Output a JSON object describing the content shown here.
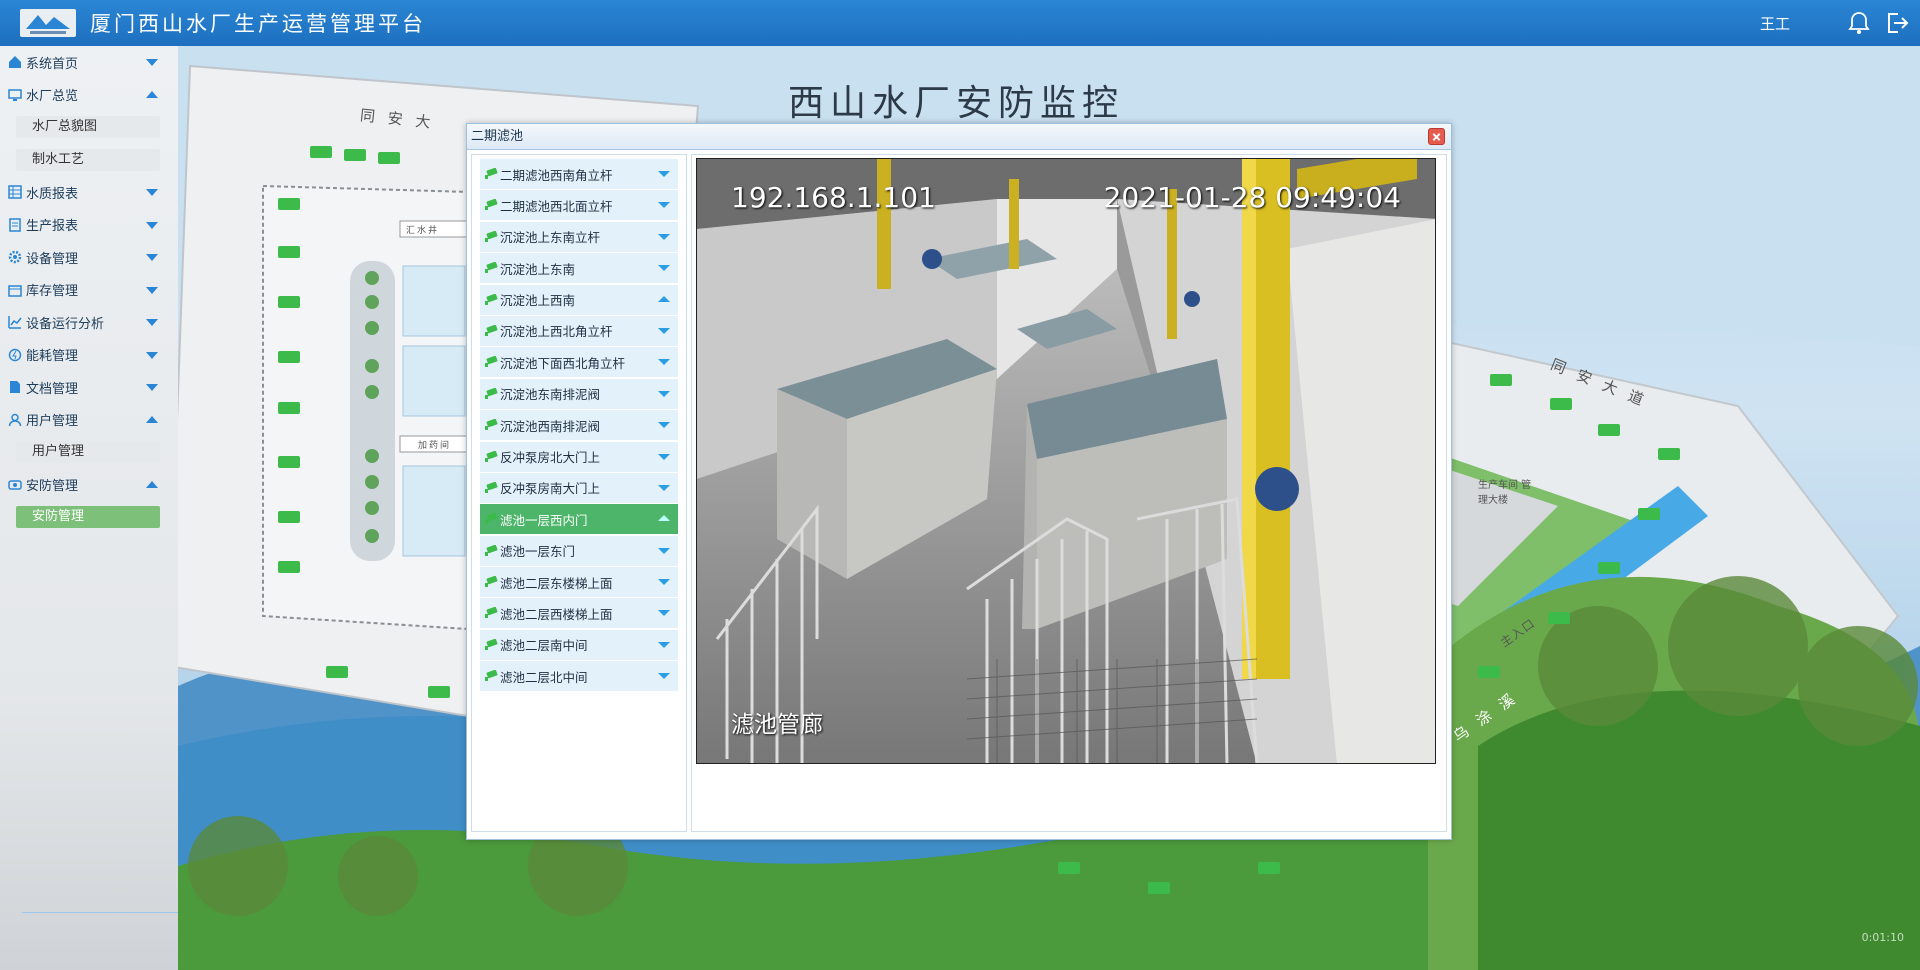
{
  "header": {
    "app_title": "厦门西山水厂生产运营管理平台",
    "user": "王工",
    "bell_icon": "bell-icon",
    "logout_icon": "logout-icon"
  },
  "sidebar": {
    "items": [
      {
        "label": "系统首页",
        "icon": "home-icon",
        "expanded": false
      },
      {
        "label": "水厂总览",
        "icon": "monitor-icon",
        "expanded": true
      },
      {
        "label": "水厂总貌图",
        "sub": true
      },
      {
        "label": "制水工艺",
        "sub": true
      },
      {
        "label": "水质报表",
        "icon": "table-icon",
        "expanded": false
      },
      {
        "label": "生产报表",
        "icon": "report-icon",
        "expanded": false
      },
      {
        "label": "设备管理",
        "icon": "gear-icon",
        "expanded": false
      },
      {
        "label": "库存管理",
        "icon": "box-icon",
        "expanded": false
      },
      {
        "label": "设备运行分析",
        "icon": "chart-icon",
        "expanded": false
      },
      {
        "label": "能耗管理",
        "icon": "energy-icon",
        "expanded": false
      },
      {
        "label": "文档管理",
        "icon": "document-icon",
        "expanded": false
      },
      {
        "label": "用户管理",
        "icon": "user-icon",
        "expanded": true
      },
      {
        "label": "用户管理",
        "sub": true
      },
      {
        "label": "安防管理",
        "icon": "shield-icon",
        "expanded": true
      },
      {
        "label": "安防管理",
        "sub": true,
        "active": true
      }
    ]
  },
  "main": {
    "page_title": "西山水厂安防监控",
    "map_labels": {
      "road_top": "同 安 大",
      "road_right": "同 安 大 道",
      "main_entrance": "主入口",
      "creek": "乌 涂 溪",
      "building": "生产车间 管理大楼",
      "water_well": "汇水井",
      "dosing": "加药间"
    },
    "timecode": "0:01:10"
  },
  "dialog": {
    "title": "二期滤池",
    "close_icon": "close-icon",
    "cameras": [
      {
        "label": "二期滤池西南角立杆",
        "dir": "down"
      },
      {
        "label": "二期滤池西北面立杆",
        "dir": "down"
      },
      {
        "label": "沉淀池上东南立杆",
        "dir": "down"
      },
      {
        "label": "沉淀池上东南",
        "dir": "down"
      },
      {
        "label": "沉淀池上西南",
        "dir": "up"
      },
      {
        "label": "沉淀池上西北角立杆",
        "dir": "down"
      },
      {
        "label": "沉淀池下面西北角立杆",
        "dir": "down"
      },
      {
        "label": "沉淀池东南排泥阀",
        "dir": "down"
      },
      {
        "label": "沉淀池西南排泥阀",
        "dir": "down"
      },
      {
        "label": "反冲泵房北大门上",
        "dir": "down"
      },
      {
        "label": "反冲泵房南大门上",
        "dir": "down"
      },
      {
        "label": "滤池一层西内门",
        "dir": "up",
        "active": true
      },
      {
        "label": "滤池一层东门",
        "dir": "down"
      },
      {
        "label": "滤池二层东楼梯上面",
        "dir": "down"
      },
      {
        "label": "滤池二层西楼梯上面",
        "dir": "down"
      },
      {
        "label": "滤池二层南中间",
        "dir": "down"
      },
      {
        "label": "滤池二层北中间",
        "dir": "down"
      }
    ],
    "video": {
      "ip": "192.168.1.101",
      "timestamp": "2021-01-28 09:49:04",
      "location_label": "滤池管廊"
    }
  },
  "colors": {
    "header_blue": "#1d6fbf",
    "active_green": "#4db56a",
    "sidebar_active": "#7dc07a",
    "arrow_blue": "#2a9ee0",
    "camera_green": "#3dbb4a"
  }
}
